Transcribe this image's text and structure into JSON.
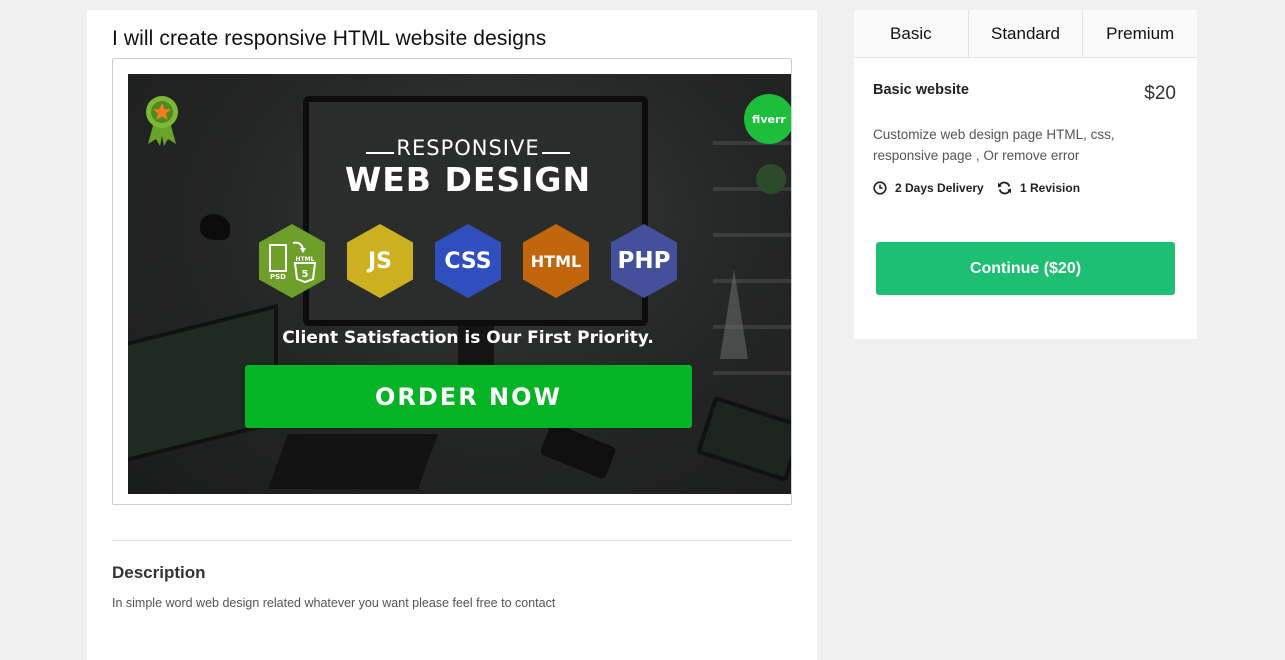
{
  "gig": {
    "title": "I will create responsive HTML website designs",
    "banner": {
      "headline_top": "RESPONSIVE",
      "headline_main": "WEB DESIGN",
      "badges": [
        "PSD→HTML",
        "JS",
        "CSS",
        "HTML",
        "PHP"
      ],
      "psd_label": "PSD",
      "html_label": "HTML",
      "tagline": "Client Satisfaction is Our First Priority.",
      "cta": "ORDER NOW",
      "logo_text": "fiverr"
    }
  },
  "description": {
    "title": "Description",
    "text": "In simple word web design related whatever you want please feel free to contact"
  },
  "pricing": {
    "tabs": [
      "Basic",
      "Standard",
      "Premium"
    ],
    "active_tab": "Basic",
    "package": {
      "name": "Basic website",
      "price": "$20",
      "description": "Customize web design page HTML, css, responsive page , Or remove error",
      "delivery": "2 Days Delivery",
      "revisions": "1 Revision"
    },
    "continue_label": "Continue ($20)"
  },
  "colors": {
    "background": "#f0f0f0",
    "continue_button": "#1dbf73",
    "order_button": "#05b424",
    "fiverr_green": "#1dbf3a"
  },
  "icons": [
    "badge-icon",
    "clock-icon",
    "refresh-icon",
    "fiverr-logo"
  ]
}
